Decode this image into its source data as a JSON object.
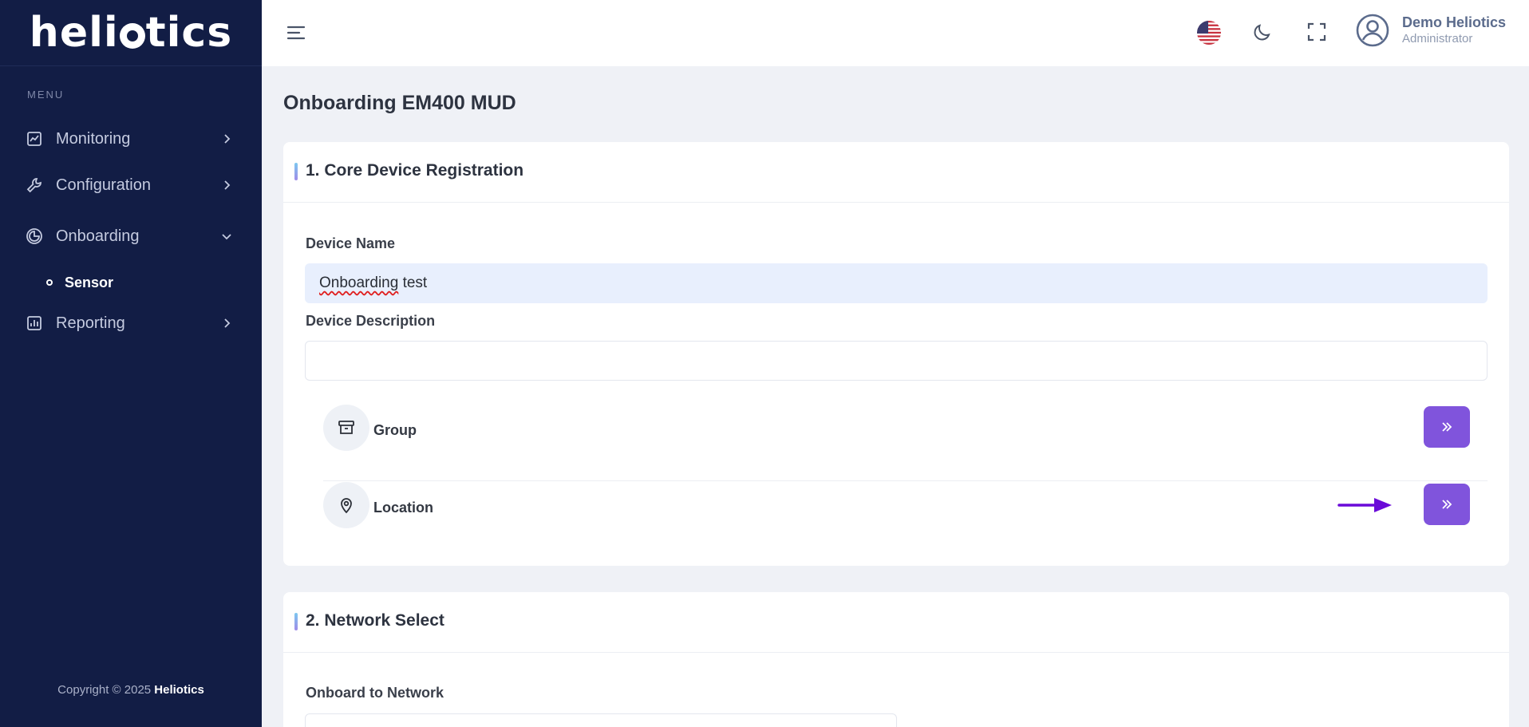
{
  "sidebar": {
    "logo_text": "heliotics",
    "menu_title": "MENU",
    "items": [
      {
        "label": "Monitoring",
        "icon": "chart-line-icon"
      },
      {
        "label": "Configuration",
        "icon": "wrench-icon"
      },
      {
        "label": "Onboarding",
        "icon": "onboarding-icon",
        "expanded": true,
        "children": [
          {
            "label": "Sensor"
          }
        ]
      },
      {
        "label": "Reporting",
        "icon": "bar-chart-icon"
      }
    ],
    "copyright_prefix": "Copyright © 2025 ",
    "copyright_brand": "Heliotics"
  },
  "topbar": {
    "icons": [
      "hamburger-menu-icon",
      "us-flag-icon",
      "moon-icon",
      "fullscreen-icon",
      "user-avatar-icon"
    ],
    "user_name": "Demo Heliotics",
    "user_role": "Administrator"
  },
  "page": {
    "title": "Onboarding EM400 MUD"
  },
  "section1": {
    "title": "1. Core Device Registration",
    "device_name_label": "Device Name",
    "device_name_value_word1": "Onboarding",
    "device_name_value_word2": " test",
    "device_description_label": "Device Description",
    "device_description_value": "",
    "group_label": "Group",
    "location_label": "Location"
  },
  "section2": {
    "title": "2. Network Select",
    "onboard_label": "Onboard to Network"
  },
  "colors": {
    "sidebar_bg": "#121d45",
    "accent_purple": "#8054dc",
    "arrow_purple": "#6a0ad8",
    "page_bg": "#eff1f6",
    "filled_input_bg": "#e8effd"
  }
}
